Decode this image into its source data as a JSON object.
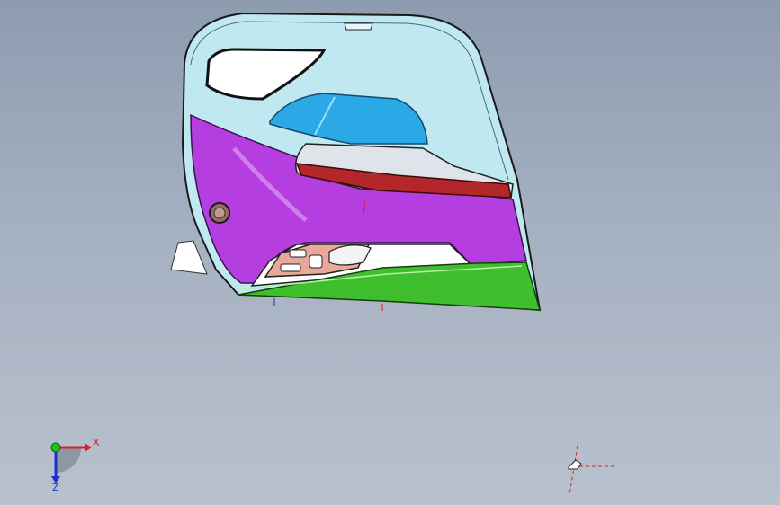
{
  "viewport": {
    "background_top": "#8e9cb0",
    "background_bottom": "#b8c1ce"
  },
  "model": {
    "part": "door-trim-panel",
    "colors": {
      "frame": "#bfe8f0",
      "window": "#ffffff",
      "armrest_glass": "#2aa9e6",
      "upholstery": "#b43ee0",
      "handle_strip": "#b3262a",
      "switch_pad": "#e8a99a",
      "map_pocket": "#3fbf2e",
      "speaker_ring": "#9a6a60"
    }
  },
  "triad": {
    "x_label": "X",
    "z_label": "Z",
    "x_color": "#e02020",
    "y_color": "#20c020",
    "z_color": "#2030d0"
  }
}
